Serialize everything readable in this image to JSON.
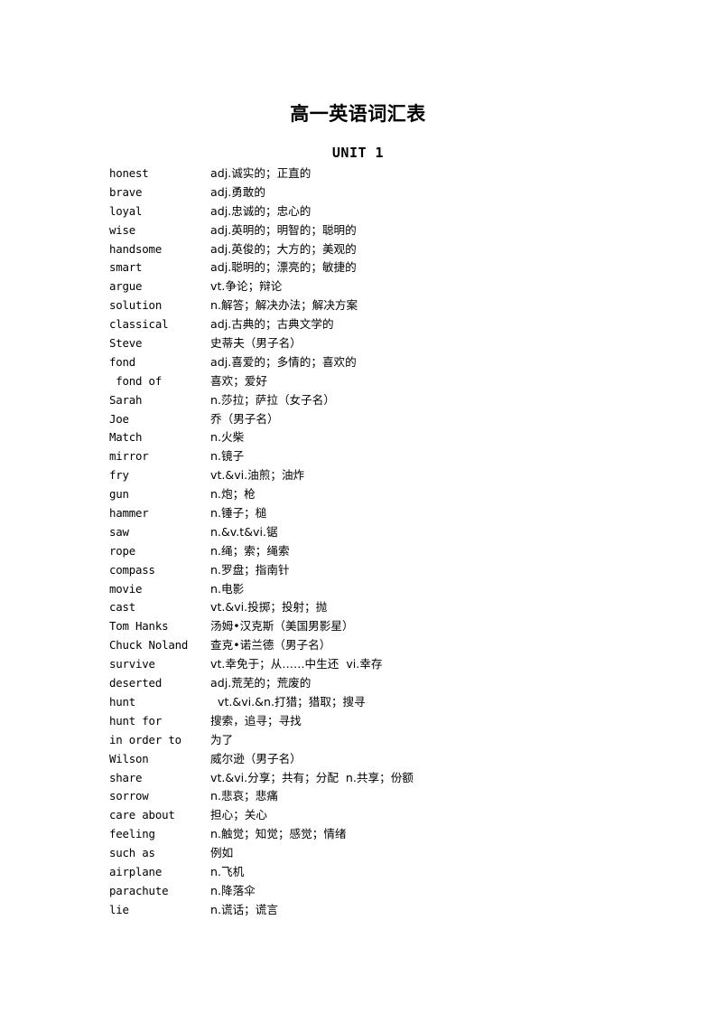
{
  "document": {
    "title": "高一英语词汇表",
    "unit_heading": "UNIT 1"
  },
  "vocabulary": [
    {
      "word": "honest",
      "definition": "adj.诚实的；正直的"
    },
    {
      "word": "brave",
      "definition": "adj.勇敢的"
    },
    {
      "word": "loyal",
      "definition": "adj.忠诚的；忠心的"
    },
    {
      "word": "wise",
      "definition": "adj.英明的；明智的；聪明的"
    },
    {
      "word": "handsome",
      "definition": "adj.英俊的；大方的；美观的"
    },
    {
      "word": "smart",
      "definition": "adj.聪明的；漂亮的；敏捷的"
    },
    {
      "word": "argue",
      "definition": "vt.争论；辩论"
    },
    {
      "word": "solution",
      "definition": "n.解答；解决办法；解决方案"
    },
    {
      "word": "classical",
      "definition": "adj.古典的；古典文学的"
    },
    {
      "word": "Steve",
      "definition": "史蒂夫（男子名）"
    },
    {
      "word": "fond",
      "definition": "adj.喜爱的；多情的；喜欢的"
    },
    {
      "word": " fond of",
      "definition": "喜欢；爱好"
    },
    {
      "word": "Sarah",
      "definition": "n.莎拉；萨拉（女子名）"
    },
    {
      "word": "Joe",
      "definition": "乔（男子名）"
    },
    {
      "word": "Match",
      "definition": "n.火柴"
    },
    {
      "word": "mirror",
      "definition": "n.镜子"
    },
    {
      "word": "fry",
      "definition": "vt.&vi.油煎；油炸"
    },
    {
      "word": "gun",
      "definition": "n.炮；枪"
    },
    {
      "word": "hammer",
      "definition": "n.锤子；槌"
    },
    {
      "word": "saw",
      "definition": "n.&v.t&vi.锯"
    },
    {
      "word": "rope",
      "definition": "n.绳；索；绳索"
    },
    {
      "word": "compass",
      "definition": "n.罗盘；指南针"
    },
    {
      "word": "movie",
      "definition": "n.电影"
    },
    {
      "word": "cast",
      "definition": "vt.&vi.投掷；投射；抛"
    },
    {
      "word": "Tom Hanks",
      "definition": "汤姆•汉克斯（美国男影星）"
    },
    {
      "word": "Chuck Noland",
      "definition": "查克•诺兰德（男子名）"
    },
    {
      "word": "survive",
      "definition": "vt.幸免于；从……中生还  vi.幸存"
    },
    {
      "word": "deserted",
      "definition": "adj.荒芜的；荒废的"
    },
    {
      "word": "hunt",
      "definition": "  vt.&vi.&n.打猎；猎取；搜寻"
    },
    {
      "word": "hunt for",
      "definition": "搜索，追寻；寻找"
    },
    {
      "word": "in order to",
      "definition": "为了"
    },
    {
      "word": "Wilson",
      "definition": "威尔逊（男子名）"
    },
    {
      "word": "share",
      "definition": "vt.&vi.分享；共有；分配  n.共享；份额"
    },
    {
      "word": "sorrow",
      "definition": "n.悲哀；悲痛"
    },
    {
      "word": "care about",
      "definition": "担心；关心"
    },
    {
      "word": "feeling",
      "definition": "n.触觉；知觉；感觉；情绪"
    },
    {
      "word": "such as",
      "definition": "例如"
    },
    {
      "word": "airplane",
      "definition": "n.飞机"
    },
    {
      "word": "parachute",
      "definition": "n.降落伞"
    },
    {
      "word": "lie",
      "definition": "n.谎话；谎言"
    }
  ]
}
